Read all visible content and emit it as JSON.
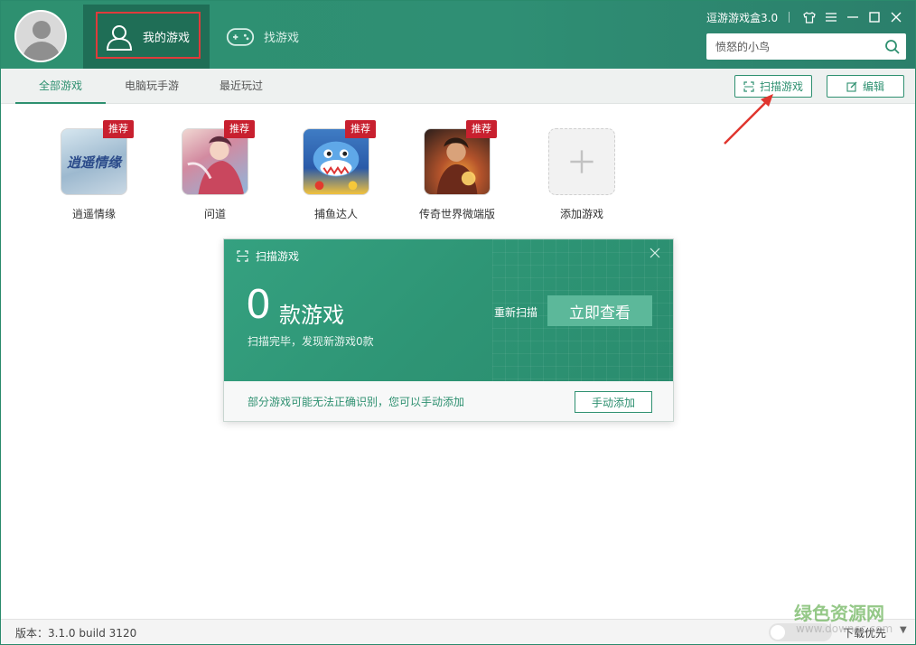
{
  "header": {
    "my_games_label": "我的游戏",
    "find_games_label": "找游戏",
    "app_name": "逗游游戏盒3.0",
    "search": {
      "value": "愤怒的小鸟",
      "placeholder": ""
    }
  },
  "subnav": {
    "tabs": [
      {
        "label": "全部游戏",
        "active": true
      },
      {
        "label": "电脑玩手游",
        "active": false
      },
      {
        "label": "最近玩过",
        "active": false
      }
    ],
    "scan_button": "扫描游戏",
    "edit_button": "编辑"
  },
  "games": [
    {
      "name": "逍遥情缘",
      "badge": "推荐",
      "thumb_text": "逍遥情缘"
    },
    {
      "name": "问道",
      "badge": "推荐",
      "thumb_text": ""
    },
    {
      "name": "捕鱼达人",
      "badge": "推荐",
      "thumb_text": ""
    },
    {
      "name": "传奇世界微端版",
      "badge": "推荐",
      "thumb_text": ""
    },
    {
      "name": "添加游戏"
    }
  ],
  "scan_popup": {
    "title": "扫描游戏",
    "count": "0",
    "count_unit": "款游戏",
    "description": "扫描完毕，发现新游戏0款",
    "rescan": "重新扫描",
    "view_button": "立即查看",
    "hint": "部分游戏可能无法正确识别，您可以手动添加",
    "manual_button": "手动添加"
  },
  "footer": {
    "version": "版本：3.1.0 build 3120",
    "download_pref": "下载优先"
  },
  "watermark": {
    "text": "绿色资源网",
    "url": "www.downcc.com"
  },
  "colors": {
    "brand": "#2e9070",
    "badge": "#c8202f",
    "highlight": "#e03b3b"
  }
}
